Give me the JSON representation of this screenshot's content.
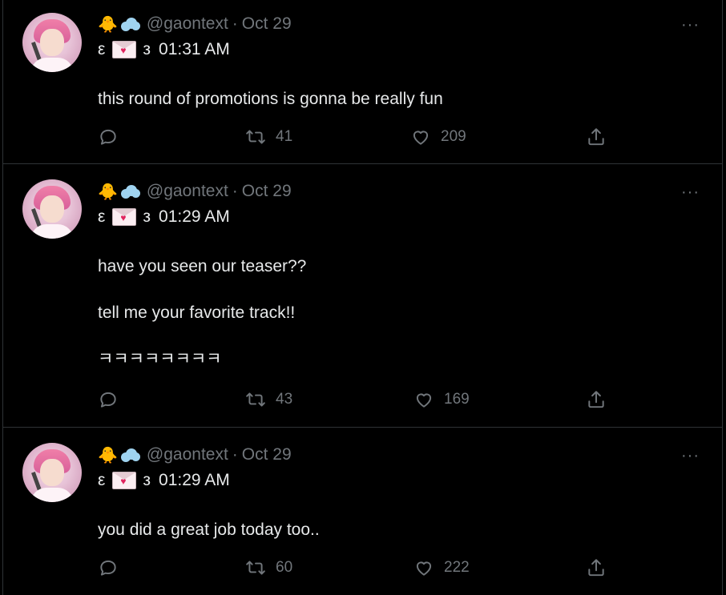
{
  "tweets": [
    {
      "handle": "@gaontext",
      "date": "Oct 29",
      "emoji": "🐥",
      "sub_left": "ε",
      "sub_right": "з",
      "time": "01:31 AM",
      "text": "this round of promotions is gonna be really fun",
      "retweets": "41",
      "likes": "209",
      "more": "···"
    },
    {
      "handle": "@gaontext",
      "date": "Oct 29",
      "emoji": "🐥",
      "sub_left": "ε",
      "sub_right": "з",
      "time": "01:29 AM",
      "text": "have you seen our teaser??\n\ntell me your favorite track!!\n\nㅋㅋㅋㅋㅋㅋㅋㅋ",
      "retweets": "43",
      "likes": "169",
      "more": "···"
    },
    {
      "handle": "@gaontext",
      "date": "Oct 29",
      "emoji": "🐥",
      "sub_left": "ε",
      "sub_right": "з",
      "time": "01:29 AM",
      "text": "you did a great job today too..",
      "retweets": "60",
      "likes": "222",
      "more": "···"
    }
  ],
  "colors": {
    "background": "#000000",
    "text": "#e7e9ea",
    "muted": "#71767b",
    "divider": "#2f3336"
  }
}
